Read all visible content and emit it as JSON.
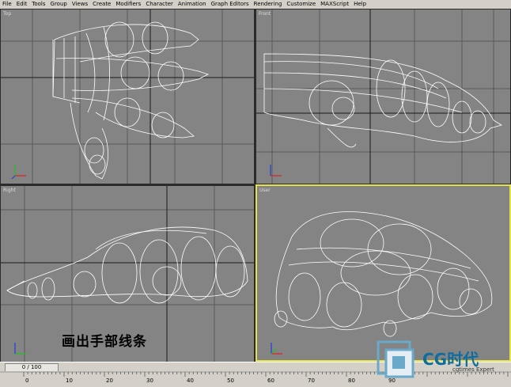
{
  "menubar": {
    "items": [
      "File",
      "Edit",
      "Tools",
      "Group",
      "Views",
      "Create",
      "Modifiers",
      "Character",
      "Animation",
      "Graph Editors",
      "Rendering",
      "Customize",
      "MAXScript",
      "Help"
    ]
  },
  "viewports": {
    "top": {
      "label": "Top"
    },
    "front": {
      "label": "Front"
    },
    "right": {
      "label": "Right"
    },
    "user": {
      "label": "User"
    }
  },
  "overlay_caption": "画出手部线条",
  "timebar": {
    "slider_text": "0 / 100"
  },
  "ruler": {
    "ticks": [
      "0",
      "10",
      "20",
      "30",
      "40",
      "50",
      "60",
      "70",
      "80",
      "90"
    ]
  },
  "logo": {
    "text": "CG时代",
    "subtext": "cgtimes Expert"
  },
  "colors": {
    "viewport_bg": "#848484",
    "wire": "#ffffff",
    "active_border": "#e8e24a",
    "ui_gray": "#d4d0c8"
  },
  "icons": [
    "axis-tripod-icon",
    "cg-logo-icon"
  ]
}
